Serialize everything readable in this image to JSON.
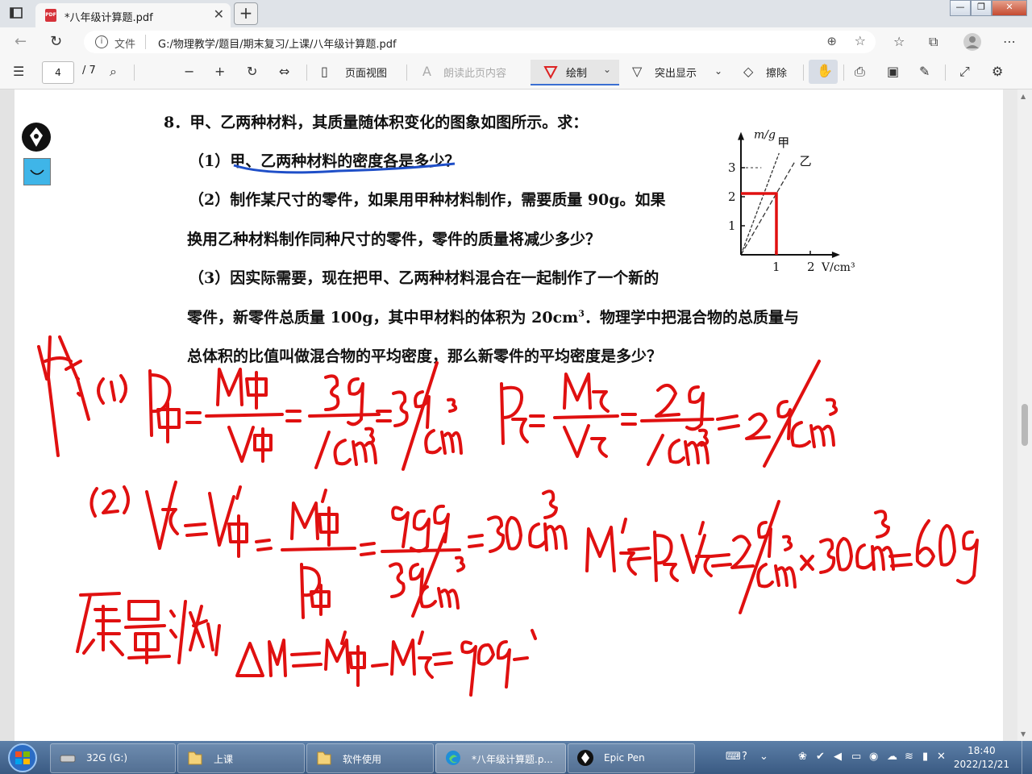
{
  "browser": {
    "tab_title": "*八年级计算题.pdf",
    "tab_close": "✕",
    "new_tab": "+",
    "win_min": "—",
    "win_max": "❐",
    "win_close": "✕",
    "address_label": "文件",
    "address_path": "G:/物理教学/题目/期末复习/上课/八年级计算题.pdf"
  },
  "pdf_toolbar": {
    "page_current": "4",
    "page_total": "/ 7",
    "page_view": "页面视图",
    "read_aloud": "朗读此页内容",
    "draw": "绘制",
    "highlight": "突出显示",
    "erase": "擦除"
  },
  "document": {
    "q_title": "8．甲、乙两种材料，其质量随体积变化的图象如图所示。求：",
    "q1": "（1）甲、乙两种材料的密度各是多少？",
    "q2_line1": "（2）制作某尺寸的零件，如果用甲种材料制作，需要质量 90g。如果",
    "q2_line2": "换用乙种材料制作同种尺寸的零件，零件的质量将减少多少？",
    "q3_line1": "（3）因实际需要，现在把甲、乙两种材料混合在一起制作了一个新的",
    "q3_line2_a": "零件，新零件总质量 100g，其中甲材料的体积为 20cm",
    "q3_line2_sup": "3",
    "q3_line2_b": "．物理学中把混合物的总质量与",
    "q3_line3": "总体积的比值叫做混合物的平均密度，那么新零件的平均密度是多少？"
  },
  "chart_data": {
    "type": "line",
    "ylabel": "m/g",
    "xlabel": "V/cm³",
    "x_ticks": [
      "1",
      "2"
    ],
    "y_ticks": [
      "1",
      "2",
      "3"
    ],
    "xlim": [
      0,
      2.3
    ],
    "ylim": [
      0,
      3.9
    ],
    "series": [
      {
        "name": "甲",
        "x": [
          0,
          1.1
        ],
        "y": [
          0,
          3.5
        ]
      },
      {
        "name": "乙",
        "x": [
          0,
          1.55
        ],
        "y": [
          0,
          3.2
        ]
      }
    ]
  },
  "taskbar": {
    "items": [
      "32G (G:)",
      "上课",
      "软件使用",
      "*八年级计算题.p...",
      "Epic Pen"
    ],
    "time": "18:40",
    "date": "2022/12/21"
  },
  "colors": {
    "ink": "#e01010",
    "underline_ink": "#1f4fc8",
    "taskbar": "#4a6c95"
  }
}
